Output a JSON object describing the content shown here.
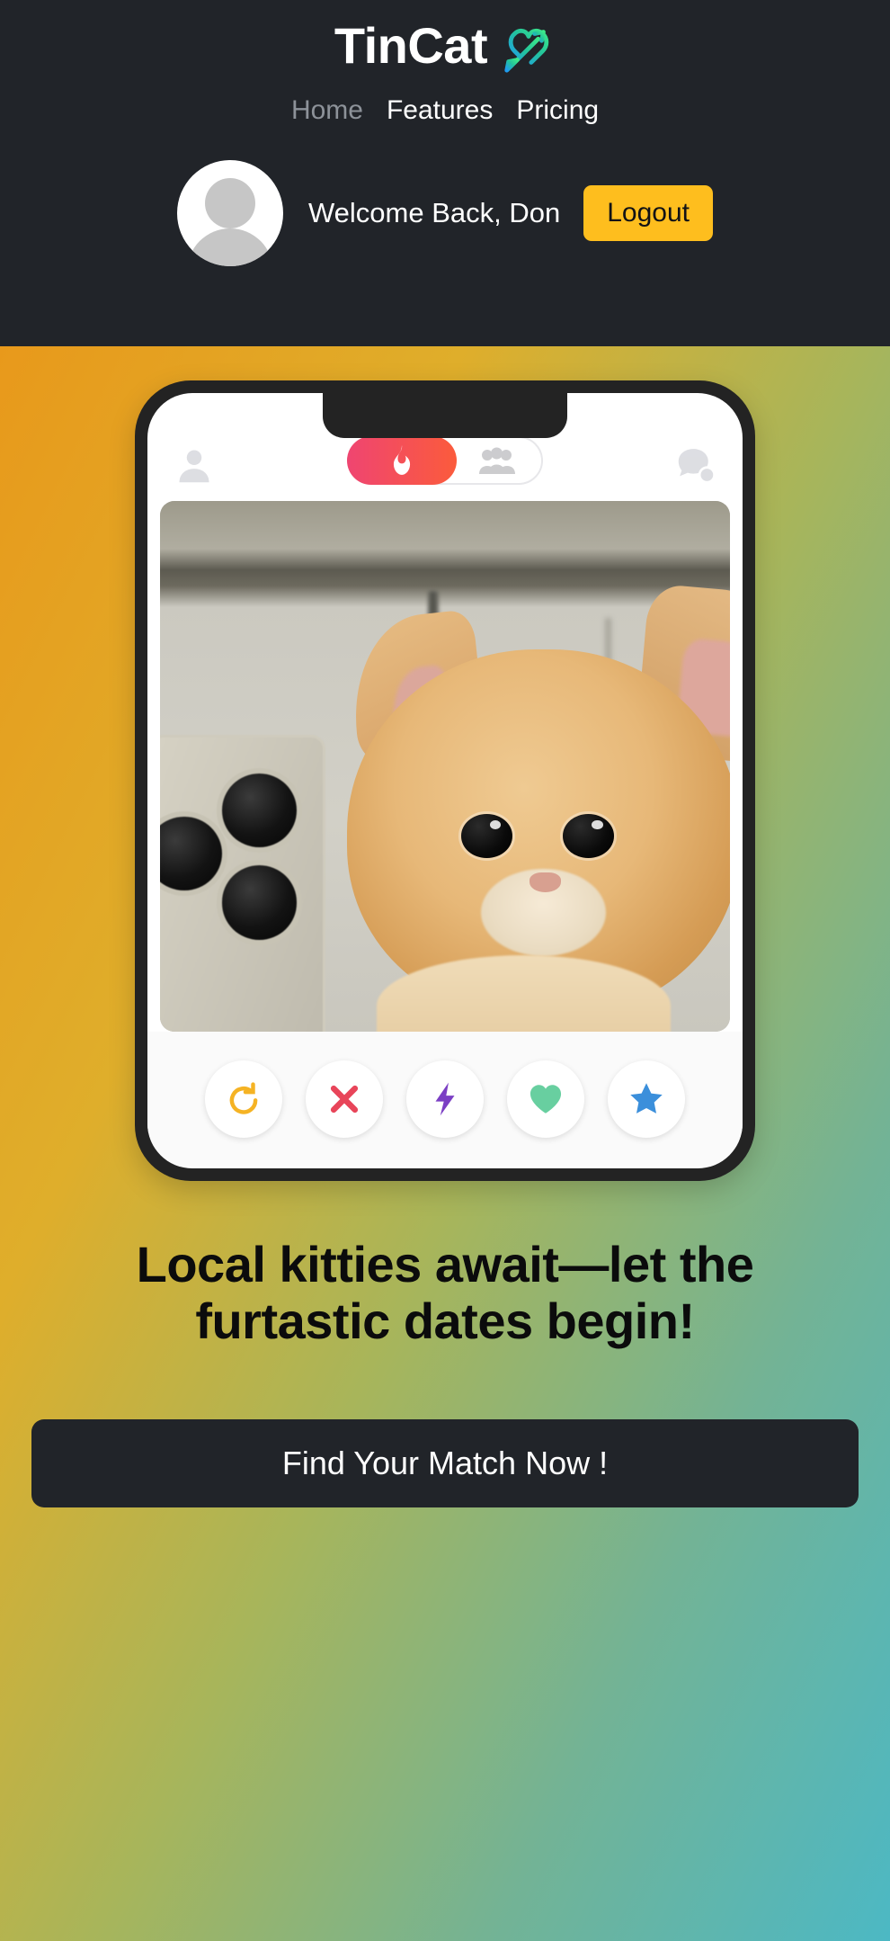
{
  "header": {
    "brand_name": "TinCat",
    "brand_icon": "heart-mars-icon",
    "nav": [
      {
        "label": "Home",
        "active": false,
        "muted": true
      },
      {
        "label": "Features",
        "active": true,
        "muted": false
      },
      {
        "label": "Pricing",
        "active": false,
        "muted": false
      }
    ],
    "avatar_icon": "user-avatar-icon",
    "welcome_text": "Welcome Back, Don",
    "logout_label": "Logout",
    "bg_color": "#212429",
    "logout_color": "#febe1e"
  },
  "hero": {
    "gradient_from": "#e8991b",
    "gradient_mid": "#a8b55a",
    "gradient_to": "#4cb8c4",
    "headline": "Local kitties await—let the furtastic dates begin!",
    "cta_label": "Find Your Match Now !",
    "cta_color": "#212429"
  },
  "phone": {
    "app_header": {
      "left_icon": "profile-icon",
      "right_icon": "chat-bubble-icon",
      "toggle": {
        "active_icon": "flame-icon",
        "inactive_icon": "people-icon",
        "active_color_start": "#ef4571",
        "active_color_end": "#fb5b3c"
      }
    },
    "card_photo_alt": "orange kitten beside a phone",
    "actions": [
      {
        "name": "rewind-button",
        "icon": "rewind-icon",
        "color": "#f5b324"
      },
      {
        "name": "nope-button",
        "icon": "close-x-icon",
        "color": "#e8455a"
      },
      {
        "name": "boost-button",
        "icon": "lightning-bolt-icon",
        "color": "#7b3fc4"
      },
      {
        "name": "like-button",
        "icon": "heart-icon",
        "color": "#68cfa0"
      },
      {
        "name": "superlike-button",
        "icon": "star-icon",
        "color": "#3b8fdb"
      }
    ]
  }
}
